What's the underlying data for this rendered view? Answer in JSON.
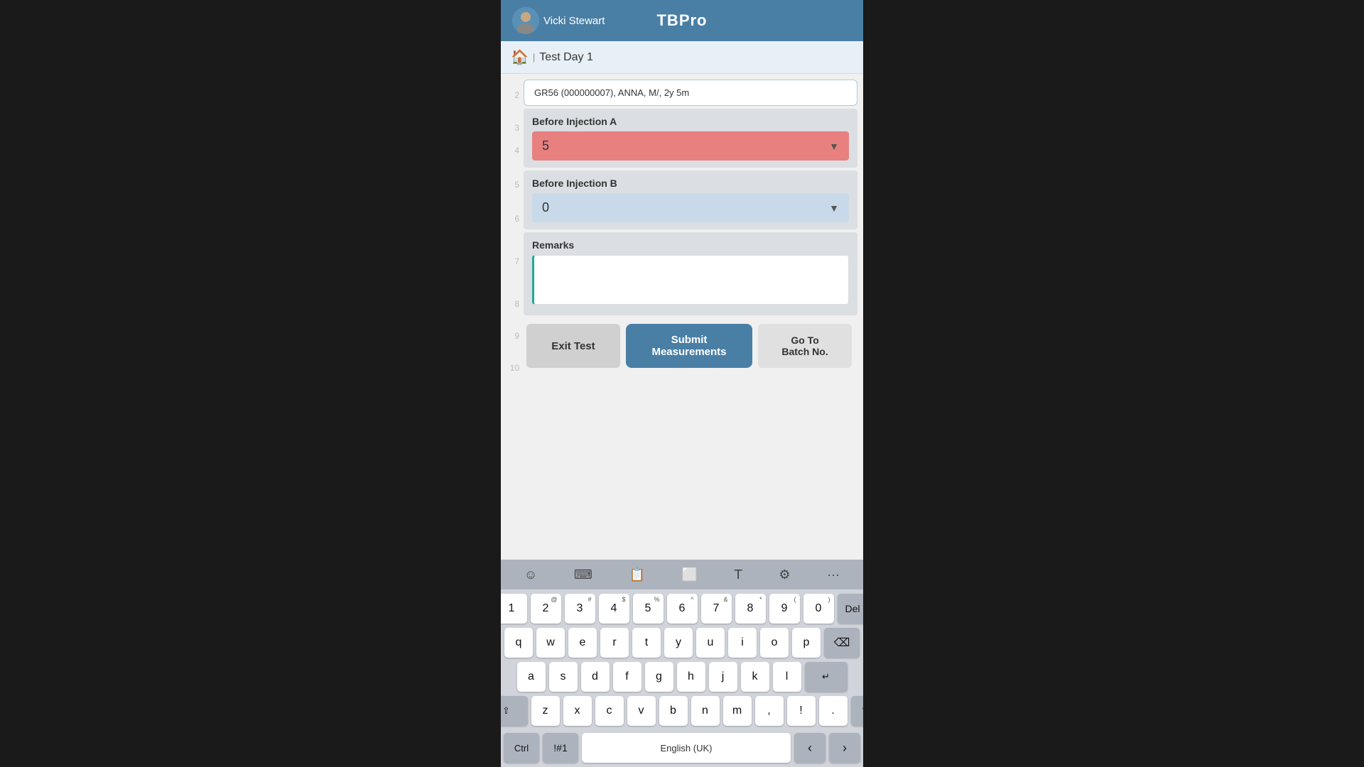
{
  "app": {
    "title_light": "TB",
    "title_bold": "Pro"
  },
  "header": {
    "username": "Vicki Stewart",
    "avatar_alt": "user-avatar"
  },
  "breadcrumb": {
    "home_icon": "🏠",
    "separator": "|",
    "page_title": "Test Day 1"
  },
  "patient_info": {
    "text": "GR56 (000000007), ANNA, M/, 2y 5m"
  },
  "line_numbers": [
    "2",
    "3",
    "4",
    "5",
    "6",
    "7",
    "8",
    "9",
    "10"
  ],
  "before_injection_a": {
    "label": "Before Injection A",
    "value": "5",
    "placeholder": "5"
  },
  "before_injection_b": {
    "label": "Before Injection B",
    "value": "0",
    "placeholder": "0"
  },
  "remarks": {
    "label": "Remarks",
    "placeholder": ""
  },
  "buttons": {
    "exit": "Exit Test",
    "submit_line1": "Submit",
    "submit_line2": "Measurements",
    "goto_line1": "Go To",
    "goto_line2": "Batch No."
  },
  "keyboard": {
    "toolbar": {
      "emoji_icon": "☺",
      "keyboard_icon": "⌨",
      "clipboard_icon": "📋",
      "screen_icon": "⬜",
      "text_icon": "𝖳",
      "settings_icon": "⚙",
      "more_icon": "···"
    },
    "num_row": [
      "1",
      "2",
      "3",
      "4",
      "5",
      "6",
      "7",
      "8",
      "9",
      "0"
    ],
    "num_superscripts": [
      "",
      "@",
      "#",
      "$",
      "%",
      "^",
      "&",
      "*",
      "(",
      ")"
    ],
    "row1": [
      "q",
      "w",
      "e",
      "r",
      "t",
      "y",
      "u",
      "i",
      "o",
      "p"
    ],
    "row2": [
      "a",
      "s",
      "d",
      "f",
      "g",
      "h",
      "j",
      "k",
      "l"
    ],
    "row3": [
      "z",
      "x",
      "c",
      "v",
      "b",
      "n",
      "m",
      ",",
      "!",
      ".",
      "?"
    ],
    "del_label": "Del",
    "backspace_icon": "⌫",
    "shift_icon": "⇧",
    "enter_icon": "↵",
    "ctrl_label": "Ctrl",
    "hash_label": "!#1",
    "space_label": "English (UK)",
    "arrow_left": "‹",
    "arrow_right": "›"
  }
}
